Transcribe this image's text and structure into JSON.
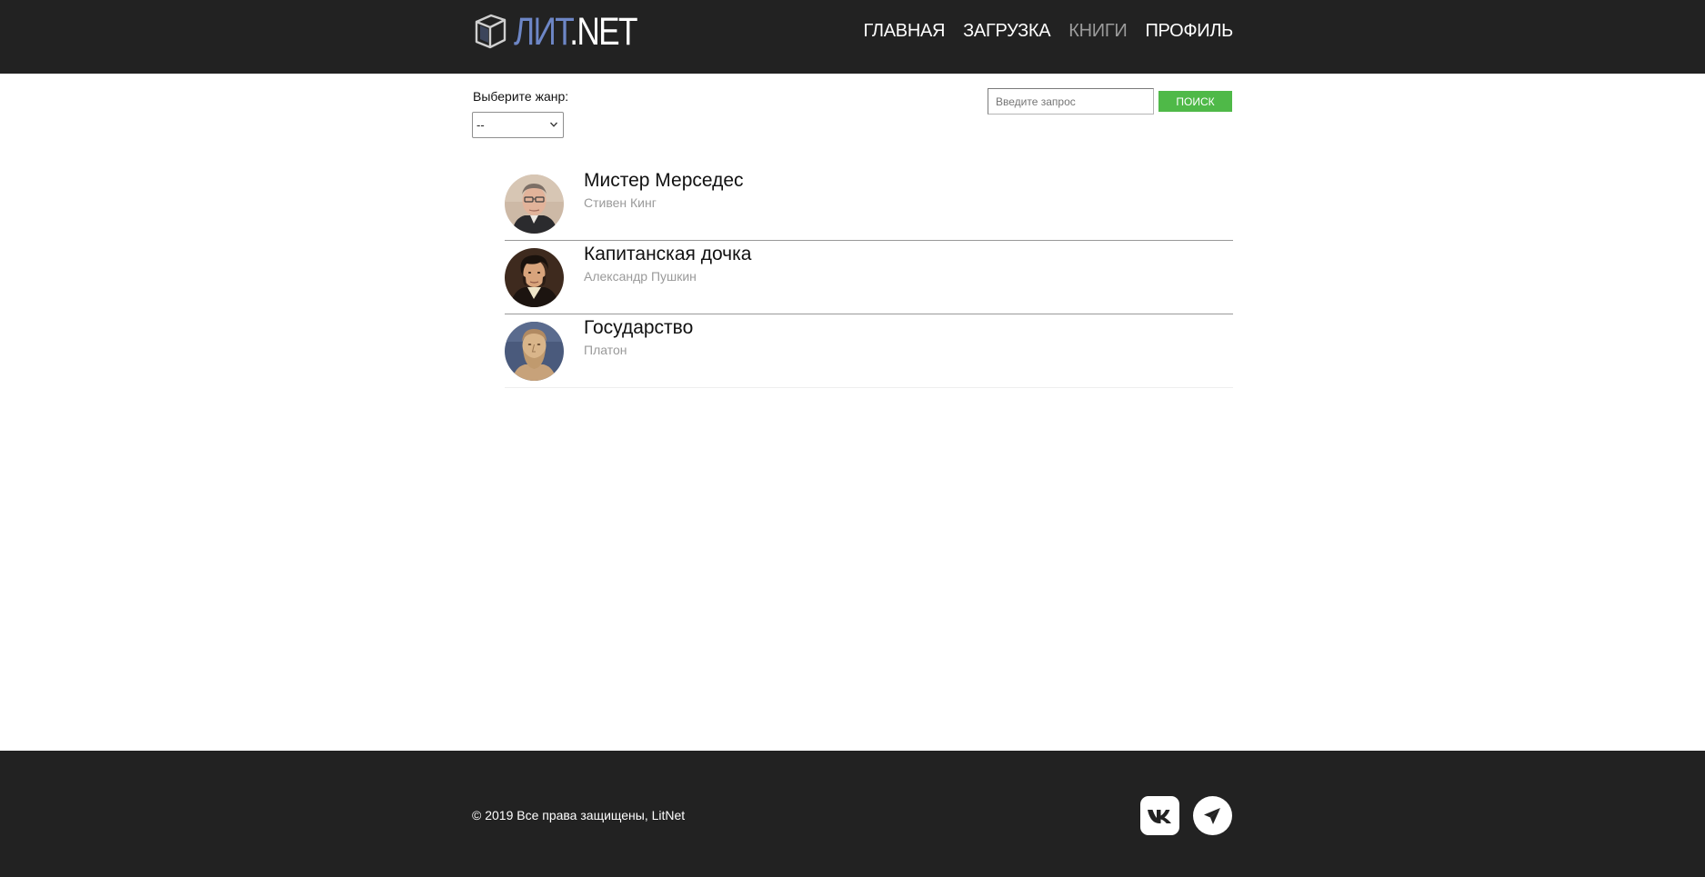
{
  "header": {
    "logo_accent": "ЛИТ",
    "logo_rest": ".NET",
    "nav": [
      {
        "label": "ГЛАВНАЯ",
        "active": false
      },
      {
        "label": "ЗАГРУЗКА",
        "active": false
      },
      {
        "label": "КНИГИ",
        "active": true
      },
      {
        "label": "ПРОФИЛЬ",
        "active": false
      }
    ]
  },
  "filter": {
    "genre_label": "Выберите жанр:",
    "genre_selected": "--"
  },
  "search": {
    "placeholder": "Введите запрос",
    "button_label": "ПОИСК"
  },
  "books": [
    {
      "title": "Мистер Мерседес",
      "author": "Стивен Кинг",
      "avatar": "stephen-king-portrait"
    },
    {
      "title": "Капитанская дочка",
      "author": "Александр Пушкин",
      "avatar": "pushkin-portrait"
    },
    {
      "title": "Государство",
      "author": "Платон",
      "avatar": "plato-portrait"
    }
  ],
  "footer": {
    "copyright": "© 2019 Все права защищены, LitNet",
    "social": [
      "vk-icon",
      "telegram-icon"
    ]
  },
  "colors": {
    "header_bg": "#222222",
    "logo_accent": "#6d86c6",
    "nav_active": "#9b9b9b",
    "search_button": "#4fb948",
    "author_text": "#9a9a9a"
  }
}
